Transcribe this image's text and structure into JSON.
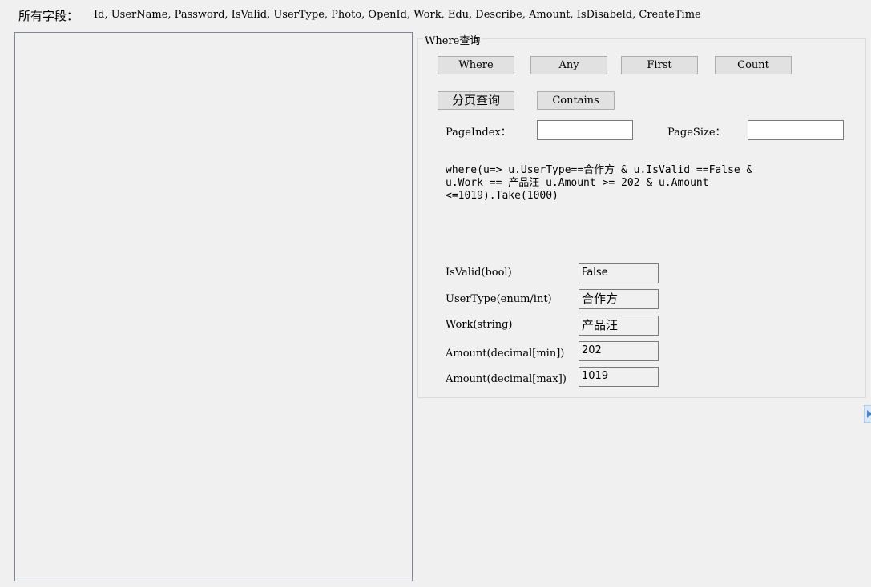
{
  "header": {
    "fields_label": "所有字段：",
    "fields_list": "Id, UserName, Password, IsValid, UserType, Photo, OpenId, Work, Edu, Describe, Amount, IsDisabeld, CreateTime"
  },
  "where_group": {
    "title": "Where查询",
    "buttons": {
      "where": "Where",
      "any": "Any",
      "first": "First",
      "count": "Count",
      "paging": "分页查询",
      "contains": "Contains"
    },
    "page_index_label": "PageIndex：",
    "page_index_value": "",
    "page_size_label": "PageSize：",
    "page_size_value": "",
    "query_text": "where(u=> u.UserType==合作方 & u.IsValid ==False & u.Work == 产品汪 u.Amount >= 202 & u.Amount <=1019).Take(1000)",
    "params": {
      "isvalid_label": "IsValid(bool)",
      "isvalid_value": "False",
      "usertype_label": "UserType(enum/int)",
      "usertype_value": "合作方",
      "work_label": "Work(string)",
      "work_value": "产品汪",
      "amount_min_label": "Amount(decimal[min])",
      "amount_min_value": "202",
      "amount_max_label": "Amount(decimal[max])",
      "amount_max_value": "1019"
    }
  },
  "results": {
    "items": []
  },
  "colors": {
    "window_bg": "#f0f0f0",
    "button_bg": "#e1e1e1",
    "button_border": "#adadad",
    "input_border": "#7a7a7a"
  },
  "icons": {
    "scroll": "scroll-right-icon"
  }
}
